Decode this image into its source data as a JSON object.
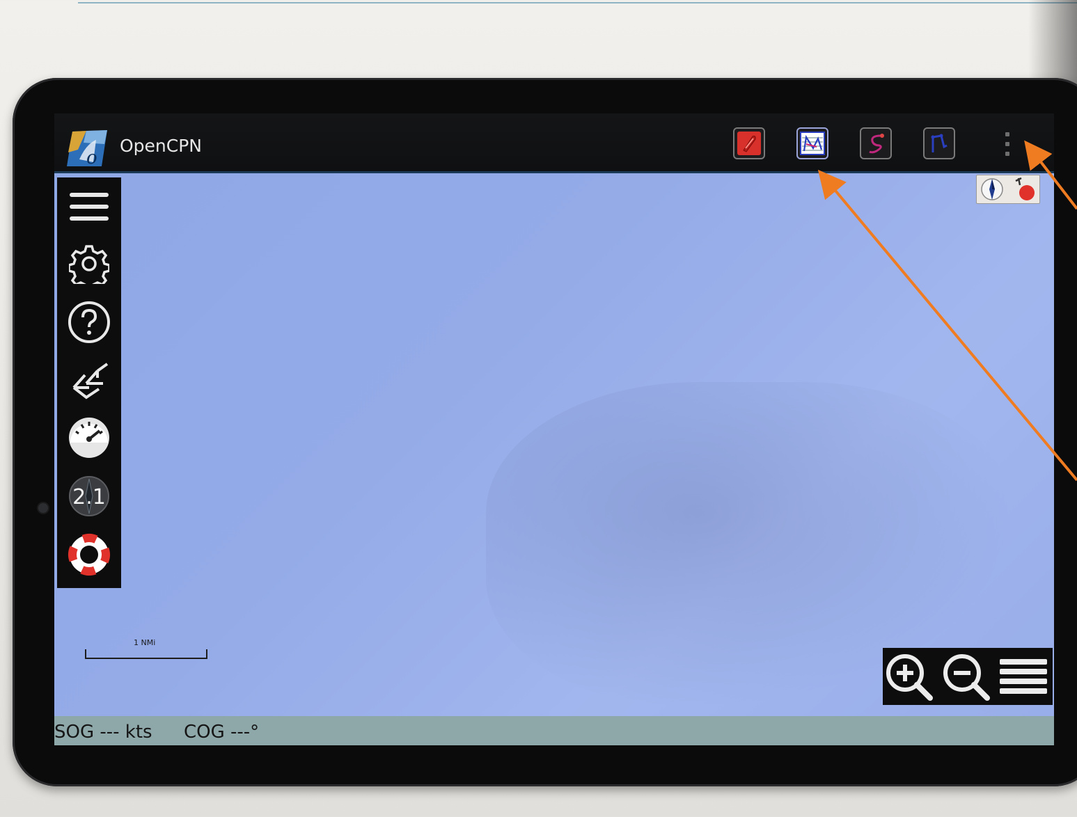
{
  "app": {
    "title": "OpenCPN",
    "logo_icon": "opencpn-logo-icon"
  },
  "toolbar": {
    "buttons": [
      {
        "name": "ownship-icon",
        "color": "#d8302a"
      },
      {
        "name": "route-manager-icon",
        "color": "#2a3fbf"
      },
      {
        "name": "track-icon",
        "color": "#c0287e"
      },
      {
        "name": "route-create-icon",
        "color": "#2a3fbf"
      }
    ],
    "overflow_icon": "more-vertical-icon"
  },
  "sidebar": {
    "items": [
      {
        "name": "menu-icon"
      },
      {
        "name": "gear-icon"
      },
      {
        "name": "help-icon"
      },
      {
        "name": "track-lines-icon"
      },
      {
        "name": "dashboard-gauge-icon"
      },
      {
        "name": "compass-version-icon",
        "label": "2.1"
      },
      {
        "name": "lifebuoy-icon"
      }
    ]
  },
  "chart": {
    "background": "#94abe8",
    "scale_label": "1 NMi"
  },
  "zoom": {
    "buttons": [
      "zoom-in-icon",
      "zoom-out-icon",
      "chart-menu-icon"
    ]
  },
  "status": {
    "sog": "SOG --- kts",
    "cog": "COG ---°"
  },
  "annotations": {
    "arrow_color": "#f07c22"
  }
}
